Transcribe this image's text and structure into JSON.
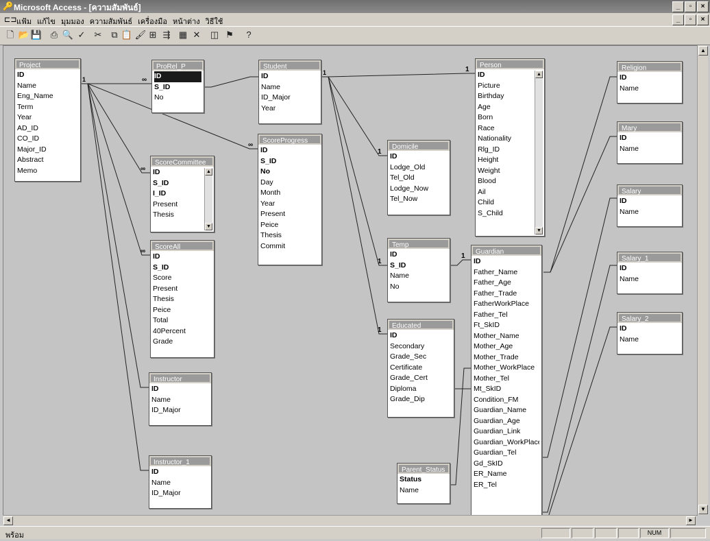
{
  "window": {
    "title": "Microsoft Access - [ความสัมพันธ์]"
  },
  "menu": {
    "items": [
      "แฟ้ม",
      "แก้ไข",
      "มุมมอง",
      "ความสัมพันธ์",
      "เครื่องมือ",
      "หน้าต่าง",
      "วิธีใช้"
    ]
  },
  "toolbar": {
    "icons": [
      "new-icon",
      "open-icon",
      "save-icon",
      "print-icon",
      "print-preview-icon",
      "spelling-icon",
      "cut-icon",
      "copy-icon",
      "paste-icon",
      "format-painter-icon",
      "show-table-icon",
      "show-direct-icon",
      "show-all-icon",
      "delete-icon",
      "new-object-icon",
      "office-links-icon",
      "help-icon"
    ]
  },
  "tables": [
    {
      "id": "project",
      "name": "Project",
      "fields": [
        "ID",
        "Name",
        "Eng_Name",
        "Term",
        "Year",
        "AD_ID",
        "CO_ID",
        "Major_ID",
        "Abstract",
        "Memo"
      ],
      "keys": [
        0
      ]
    },
    {
      "id": "prorel",
      "name": "ProRel_P",
      "fields": [
        "ID",
        "S_ID",
        "No"
      ],
      "keys": [
        0,
        1
      ],
      "selected": 0
    },
    {
      "id": "student",
      "name": "Student",
      "fields": [
        "ID",
        "Name",
        "ID_Major",
        "Year"
      ],
      "keys": [
        0
      ]
    },
    {
      "id": "scoreprogress",
      "name": "ScoreProgress",
      "fields": [
        "ID",
        "S_ID",
        "No",
        "Day",
        "Month",
        "Year",
        "Present",
        "Peice",
        "Thesis",
        "Commit"
      ],
      "keys": [
        0,
        1,
        2
      ]
    },
    {
      "id": "scorecommittee",
      "name": "ScoreCommittee",
      "fields": [
        "ID",
        "S_ID",
        "I_ID",
        "Present",
        "Thesis"
      ],
      "keys": [
        0,
        1,
        2
      ],
      "scroll": true
    },
    {
      "id": "scoreall",
      "name": "ScoreAll",
      "fields": [
        "ID",
        "S_ID",
        "Score",
        "Present",
        "Thesis",
        "Peice",
        "Total",
        "40Percent",
        "Grade"
      ],
      "keys": [
        0,
        1
      ]
    },
    {
      "id": "instructor",
      "name": "Instructor",
      "fields": [
        "ID",
        "Name",
        "ID_Major"
      ],
      "keys": [
        0
      ]
    },
    {
      "id": "instructor1",
      "name": "Instructor_1",
      "fields": [
        "ID",
        "Name",
        "ID_Major"
      ],
      "keys": [
        0
      ]
    },
    {
      "id": "domicile",
      "name": "Domicile",
      "fields": [
        "ID",
        "Lodge_Old",
        "Tel_Old",
        "Lodge_Now",
        "Tel_Now"
      ],
      "keys": [
        0
      ]
    },
    {
      "id": "temp",
      "name": "Temp",
      "fields": [
        "ID",
        "S_ID",
        "Name",
        "No"
      ],
      "keys": [
        0,
        1
      ]
    },
    {
      "id": "educated",
      "name": "Educated",
      "fields": [
        "ID",
        "Secondary",
        "Grade_Sec",
        "Certificate",
        "Grade_Cert",
        "Diploma",
        "Grade_Dip"
      ],
      "keys": [
        0
      ]
    },
    {
      "id": "parentstatus",
      "name": "Parent_Status",
      "fields": [
        "Status",
        "Name"
      ],
      "keys": [
        0
      ]
    },
    {
      "id": "person",
      "name": "Person",
      "fields": [
        "ID",
        "Picture",
        "Birthday",
        "Age",
        "Born",
        "Race",
        "Nationality",
        "Rlg_ID",
        "Height",
        "Weight",
        "Blood",
        "Ail",
        "Child",
        "S_Child"
      ],
      "keys": [
        0
      ],
      "scroll": true
    },
    {
      "id": "guardian",
      "name": "Guardian",
      "fields": [
        "ID",
        "Father_Name",
        "Father_Age",
        "Father_Trade",
        "FatherWorkPlace",
        "Father_Tel",
        "Ft_SkID",
        "Mother_Name",
        "Mother_Age",
        "Mother_Trade",
        "Mother_WorkPlace",
        "Mother_Tel",
        "Mt_SkID",
        "Condition_FM",
        "Guardian_Name",
        "Guardian_Age",
        "Guardian_Link",
        "Guardian_WorkPlace",
        "Guardian_Tel",
        "Gd_SkID",
        "ER_Name",
        "ER_Tel"
      ],
      "keys": [
        0
      ]
    },
    {
      "id": "religion",
      "name": "Religion",
      "fields": [
        "ID",
        "Name"
      ],
      "keys": [
        0
      ]
    },
    {
      "id": "mary",
      "name": "Mary",
      "fields": [
        "ID",
        "Name"
      ],
      "keys": [
        0
      ]
    },
    {
      "id": "salary",
      "name": "Salary",
      "fields": [
        "ID",
        "Name"
      ],
      "keys": [
        0
      ]
    },
    {
      "id": "salary1",
      "name": "Salary_1",
      "fields": [
        "ID",
        "Name"
      ],
      "keys": [
        0
      ]
    },
    {
      "id": "salary2",
      "name": "Salary_2",
      "fields": [
        "ID",
        "Name"
      ],
      "keys": [
        0
      ]
    }
  ],
  "relations": [
    {
      "from": "project",
      "to": "prorel",
      "one": "1",
      "many": "∞"
    },
    {
      "from": "project",
      "to": "scoreprogress",
      "one": "",
      "many": "∞"
    },
    {
      "from": "project",
      "to": "scorecommittee",
      "one": "",
      "many": "∞"
    },
    {
      "from": "project",
      "to": "scoreall",
      "one": "",
      "many": "∞"
    },
    {
      "from": "project",
      "to": "instructor",
      "one": "",
      ":many": ""
    },
    {
      "from": "project",
      "to": "instructor1",
      "one": "",
      "many": ""
    },
    {
      "from": "prorel",
      "to": "student",
      "one": "",
      "many": ""
    },
    {
      "from": "student",
      "to": "domicile",
      "one": "1",
      "many": "1"
    },
    {
      "from": "student",
      "to": "temp",
      "one": "",
      "many": "1"
    },
    {
      "from": "student",
      "to": "educated",
      "one": "",
      "many": "1"
    },
    {
      "from": "student",
      "to": "person",
      "one": "",
      "many": "1"
    },
    {
      "from": "temp",
      "to": "guardian",
      "one": "",
      "many": "1"
    }
  ],
  "status": {
    "message": "พร้อม",
    "num": "NUM"
  }
}
